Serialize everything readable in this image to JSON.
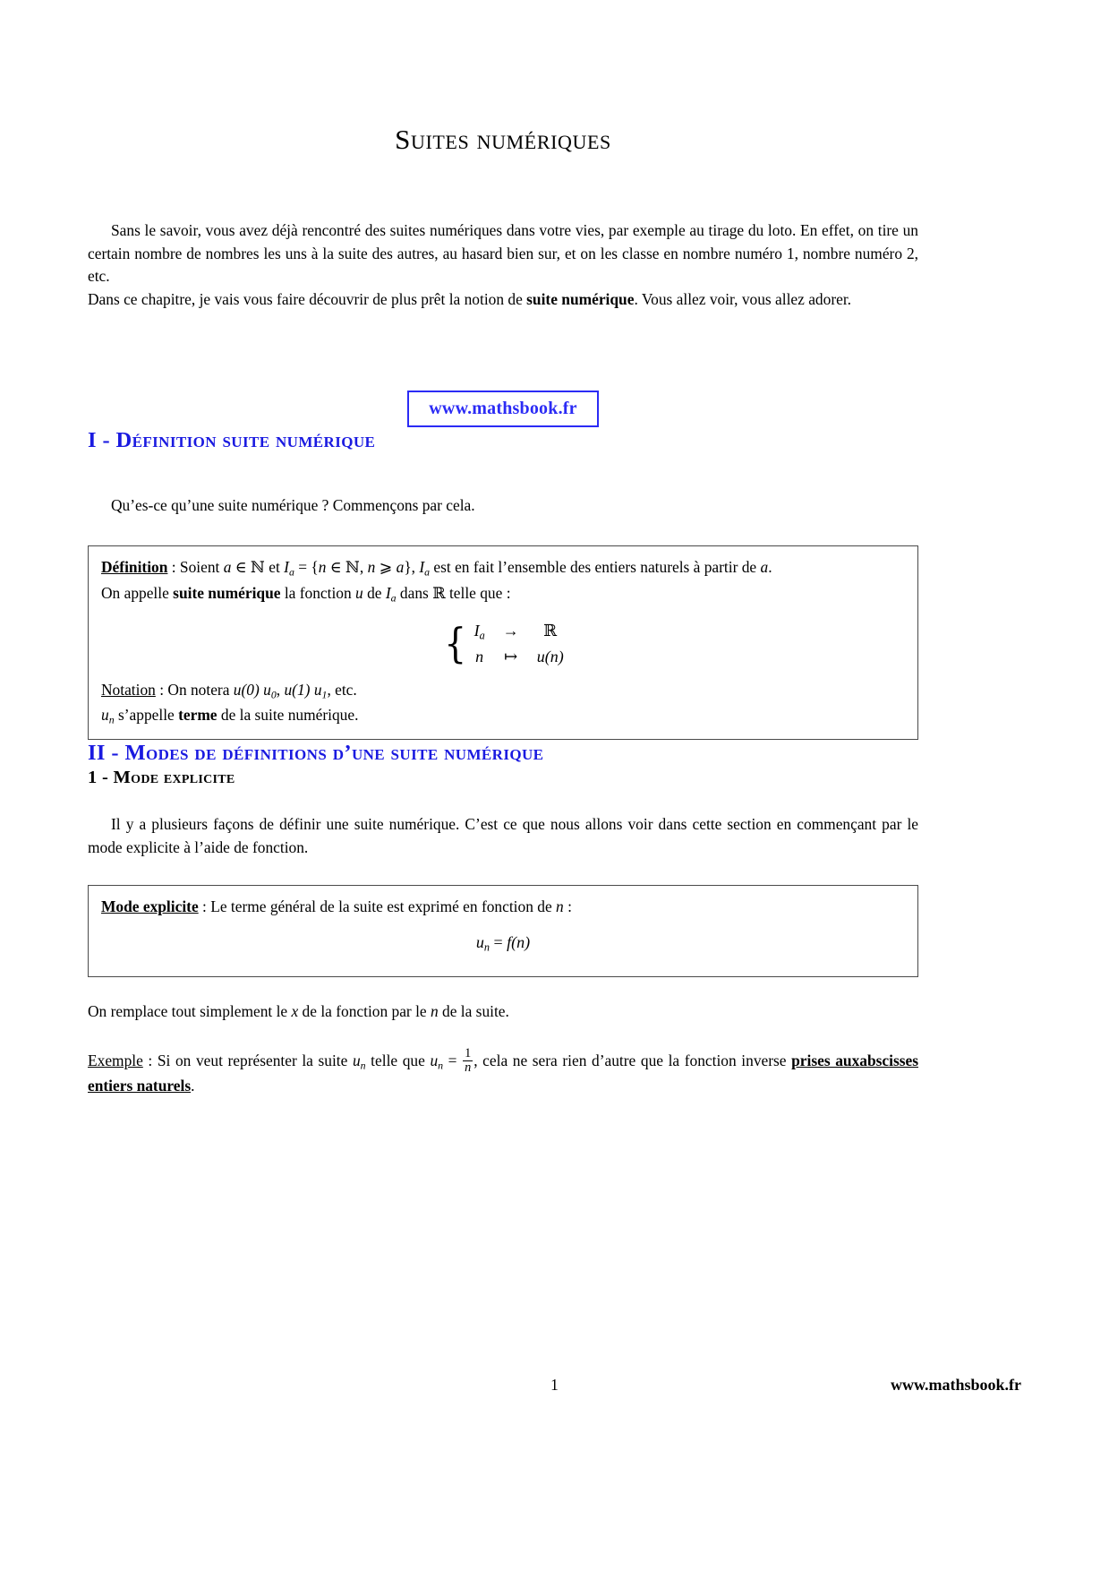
{
  "document": {
    "title": "Suites numériques",
    "intro_paragraph_1": "Sans le savoir, vous avez déjà rencontré des suites numériques dans votre vies, par exemple au tirage du loto. En effet, on tire un certain nombre de nombres les uns à la suite des autres, au hasard bien sur, et on les classe en nombre numéro 1, nombre numéro 2, etc.",
    "intro_paragraph_2_before": "Dans ce chapitre, je vais vous faire découvrir de plus prêt la notion de ",
    "intro_paragraph_2_bold": "suite numérique",
    "intro_paragraph_2_after": ". Vous allez voir, vous allez adorer."
  },
  "badge": {
    "label": "www.mathsbook.fr",
    "color": "#2b2bf5"
  },
  "sections": {
    "section_1": {
      "heading": "I - Définition suite numérique",
      "lead_paragraph": "Qu’es-ce qu’une suite numérique ? Commençons par cela.",
      "definition_box": {
        "label": "Définition",
        "line1_part1": " : Soient ",
        "line1_a": "a",
        "line1_in": " ∈ ",
        "line1_N": "ℕ",
        "line1_et": " et ",
        "line1_Ia": "I",
        "line1_Ia_sub": "a",
        "line1_eq": " = {",
        "line1_n": "n",
        "line1_inN": " ∈ ℕ, ",
        "line1_n2": "n",
        "line1_geq": " ⩾ ",
        "line1_a2": "a",
        "line1_close": "}, ",
        "line1_Ia2": "I",
        "line1_Ia2_sub": "a",
        "line1_rest": " est en fait l’ensemble des entiers naturels à partir de ",
        "line1_end_a": "a",
        "line1_period": ".",
        "line2_part1": "On appelle ",
        "line2_bold": "suite numérique",
        "line2_part2": " la fonction ",
        "line2_u": "u",
        "line2_part3": " de ",
        "line2_Ia": "I",
        "line2_Ia_sub": "a",
        "line2_part4": " dans ",
        "line2_R": "ℝ",
        "line2_part5": " telle que :",
        "system": {
          "row1_left": "I",
          "row1_left_sub": "a",
          "row1_arrow": "→",
          "row1_right": "ℝ",
          "row2_left": "n",
          "row2_arrow": "↦",
          "row2_right_u": "u",
          "row2_right_rest": "(n)"
        },
        "notation_label": "Notation",
        "notation_line1_part1": " : On notera ",
        "notation_u0a": "u",
        "notation_u0a_rest": "(0) ",
        "notation_u0b": "u",
        "notation_u0b_sub": "0",
        "notation_comma": ", ",
        "notation_u1a": "u",
        "notation_u1a_rest": "(1) ",
        "notation_u1b": "u",
        "notation_u1b_sub": "1",
        "notation_etc": ", etc.",
        "notation_line2_un": "u",
        "notation_line2_un_sub": "n",
        "notation_line2_part1": " s’appelle ",
        "notation_line2_bold": "terme",
        "notation_line2_part2": " de la suite numérique."
      }
    },
    "section_2": {
      "heading": "II - Modes de définitions d’une suite numérique",
      "subsection_1": {
        "heading": "1 - Mode explicite",
        "paragraph": "Il y a plusieurs façons de définir une suite numérique. C’est ce que nous allons voir dans cette section en commençant par le mode explicite à l’aide de fonction.",
        "mode_box": {
          "label": "Mode explicite",
          "text_part1": " : Le terme général de la suite est exprimé en fonction de ",
          "text_n": "n",
          "text_part2": " :",
          "formula_u": "u",
          "formula_u_sub": "n",
          "formula_eq": " = ",
          "formula_f": "f",
          "formula_rest": "(n)"
        },
        "after_box_part1": "On remplace tout simplement le ",
        "after_box_x": "x",
        "after_box_part2": " de la fonction par le ",
        "after_box_n": "n",
        "after_box_part3": " de la suite.",
        "example_label": "Exemple",
        "example_part1": " : Si on veut représenter la suite ",
        "example_un": "u",
        "example_un_sub": "n",
        "example_part2": " telle que ",
        "example_un2": "u",
        "example_un2_sub": "n",
        "example_eq": " = ",
        "example_frac_num": "1",
        "example_frac_den": "n",
        "example_part3": ", cela ne sera rien d’autre que la fonction inverse ",
        "example_bold_underline_1": "prises aux",
        "example_bold_underline_2": "abscisses entiers naturels",
        "example_end": "."
      }
    }
  },
  "footer": {
    "page_number": "1",
    "site": "www.mathsbook.fr"
  }
}
